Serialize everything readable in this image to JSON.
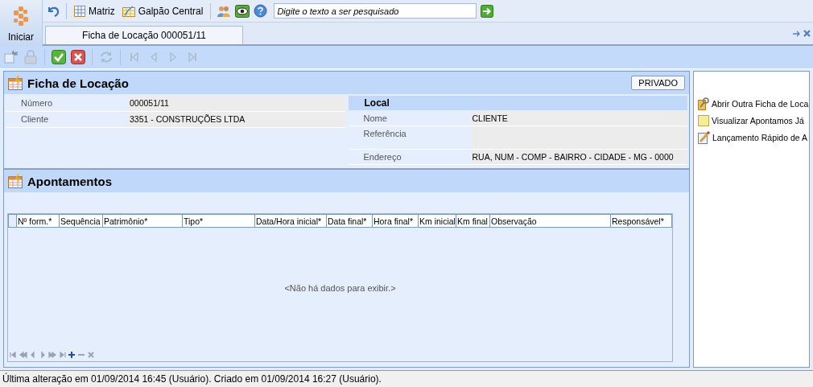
{
  "app_menu": {
    "label": "Iniciar"
  },
  "top_toolbar": {
    "company": "Matriz",
    "branch": "Galpão Central",
    "search": {
      "placeholder": "Digite o texto a ser pesquisado"
    }
  },
  "tabs": [
    {
      "label": "Ficha de Locação 000051/11",
      "selected": true
    }
  ],
  "record_toolbar": [
    {
      "kind": "new",
      "disabled": true
    },
    {
      "kind": "lock",
      "disabled": true
    },
    {
      "kind": "confirm",
      "disabled": false
    },
    {
      "kind": "cancel",
      "disabled": false
    },
    {
      "kind": "refresh",
      "disabled": true
    },
    {
      "kind": "first",
      "disabled": true
    },
    {
      "kind": "prev",
      "disabled": true
    },
    {
      "kind": "next",
      "disabled": true
    },
    {
      "kind": "last",
      "disabled": true
    }
  ],
  "form": {
    "title": "Ficha de Locação",
    "privacy_button": "PRIVADO",
    "fields": [
      {
        "label": "Número",
        "value": "000051/11"
      },
      {
        "label": "Cliente",
        "value": "3351 - CONSTRUÇÕES LTDA"
      }
    ],
    "local": {
      "title": "Local",
      "fields": [
        {
          "label": "Nome",
          "value": "CLIENTE"
        },
        {
          "label": "Referência"
        },
        {
          "label": "Endereço",
          "value": "RUA, NUM - COMP - BAIRRO - CIDADE - MG - 0000"
        }
      ]
    }
  },
  "appointments": {
    "title": "Apontamentos",
    "columns": [
      "Nº form.*",
      "Sequência",
      "Patrimônio*",
      "Tipo*",
      "Data/Hora inicial*",
      "Data final*",
      "Hora final*",
      "Km inicial",
      "Km final",
      "Observação",
      "Responsável*"
    ],
    "empty_message": "<Não há dados para exibir.>",
    "navigator": [
      {
        "kind": "first",
        "disabled": true
      },
      {
        "kind": "prevpage",
        "disabled": true
      },
      {
        "kind": "prev",
        "disabled": true
      },
      {
        "kind": "next",
        "disabled": true
      },
      {
        "kind": "nextpage",
        "disabled": true
      },
      {
        "kind": "last",
        "disabled": true
      },
      {
        "kind": "add",
        "disabled": false
      },
      {
        "kind": "remove",
        "disabled": true
      },
      {
        "kind": "cancel",
        "disabled": true
      }
    ]
  },
  "actions": [
    {
      "kind": "open",
      "label": "Abrir Outra Ficha de Loca"
    },
    {
      "kind": "view",
      "label": "Visualizar Apontamos Já"
    },
    {
      "kind": "quick",
      "label": "Lançamento Rápido de A"
    }
  ],
  "status_bar": "Última alteração em 01/09/2014 16:45 (Usuário). Criado em 01/09/2014 16:27 (Usuário)."
}
